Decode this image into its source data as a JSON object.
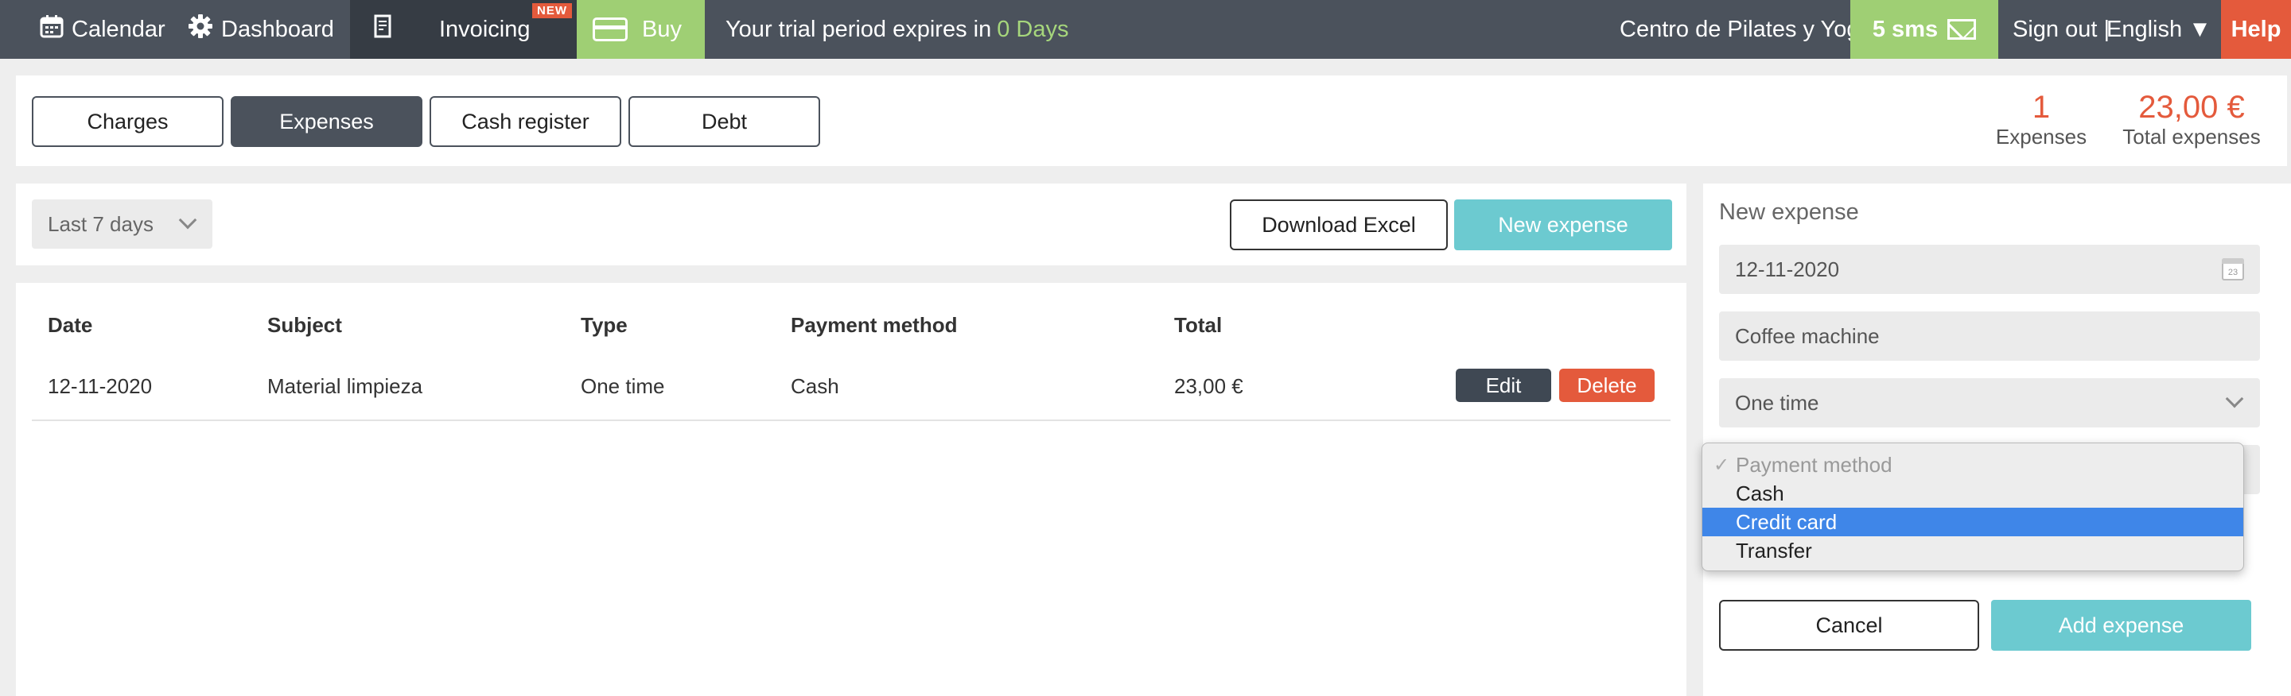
{
  "topbar": {
    "calendar": "Calendar",
    "dashboard": "Dashboard",
    "invoicing": "Invoicing",
    "new_badge": "NEW",
    "buy": "Buy",
    "trial_text": "Your trial period expires in",
    "trial_days": "0 Days",
    "center_name": "Centro de Pilates y Yoga",
    "sms": "5 sms",
    "signout": "Sign out |",
    "language": "English ▼",
    "help": "Help"
  },
  "tabs": [
    "Charges",
    "Expenses",
    "Cash register",
    "Debt"
  ],
  "active_tab": "Expenses",
  "stats": {
    "expenses_count": "1",
    "expenses_label": "Expenses",
    "total_value": "23,00 €",
    "total_label": "Total expenses"
  },
  "filter": {
    "range": "Last 7 days",
    "download": "Download Excel",
    "new_expense": "New expense"
  },
  "table": {
    "headers": [
      "Date",
      "Subject",
      "Type",
      "Payment method",
      "Total"
    ],
    "rows": [
      {
        "date": "12-11-2020",
        "subject": "Material limpieza",
        "type": "One time",
        "payment": "Cash",
        "total": "23,00 €",
        "edit": "Edit",
        "delete": "Delete"
      }
    ]
  },
  "form": {
    "title": "New expense",
    "date": "12-11-2020",
    "calendar_day": "23",
    "subject": "Coffee machine",
    "type": "One time",
    "cancel": "Cancel",
    "add": "Add expense"
  },
  "payment_dropdown": {
    "placeholder": "Payment method",
    "options": [
      "Cash",
      "Credit card",
      "Transfer"
    ],
    "highlighted": "Credit card",
    "check": "✓"
  },
  "colors": {
    "nav_bg": "#4b525c",
    "green": "#9fcf74",
    "red": "#e45a3c",
    "teal": "#6ccad0",
    "highlight": "#3f86e8"
  }
}
